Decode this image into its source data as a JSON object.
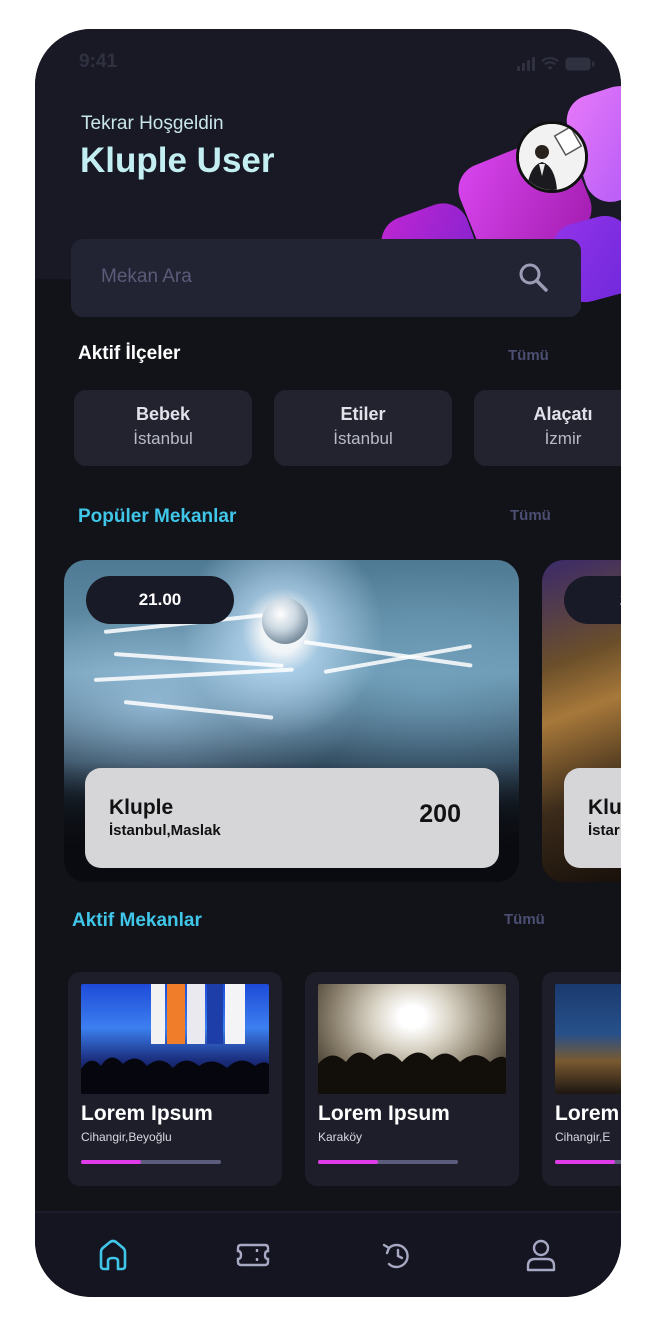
{
  "status_bar": {
    "time": "9:41"
  },
  "header": {
    "greeting": "Tekrar Hoşgeldin",
    "username": "Kluple User"
  },
  "search": {
    "placeholder": "Mekan Ara"
  },
  "districts_section": {
    "title": "Aktif İlçeler",
    "see_all": "Tümü",
    "items": [
      {
        "name": "Bebek",
        "city": "İstanbul"
      },
      {
        "name": "Etiler",
        "city": "İstanbul"
      },
      {
        "name": "Alaçatı",
        "city": "İzmir"
      }
    ]
  },
  "popular_section": {
    "title": "Popüler Mekanlar",
    "see_all": "Tümü",
    "cards": [
      {
        "time": "21.00",
        "name": "Kluple",
        "location": "İstanbul,Maslak",
        "price": "200"
      },
      {
        "time": "2",
        "name": "Klu",
        "location": "İstar"
      }
    ]
  },
  "active_section": {
    "title": "Aktif Mekanlar",
    "see_all": "Tümü",
    "cards": [
      {
        "name": "Lorem Ipsum",
        "location": "Cihangir,Beyoğlu",
        "progress": 0.43
      },
      {
        "name": "Lorem Ipsum",
        "location": "Karaköy",
        "progress": 0.43
      },
      {
        "name": "Lorem",
        "location": "Cihangir,E",
        "progress": 0.43
      }
    ]
  },
  "colors": {
    "background": "#121319",
    "accent_cyan": "#3fc6e9",
    "accent_magenta": "#e03be8",
    "card": "#1d1e2a"
  },
  "bottom_nav": {
    "items": [
      {
        "icon": "home-icon",
        "active": true
      },
      {
        "icon": "ticket-icon",
        "active": false
      },
      {
        "icon": "history-icon",
        "active": false
      },
      {
        "icon": "profile-icon",
        "active": false
      }
    ]
  }
}
